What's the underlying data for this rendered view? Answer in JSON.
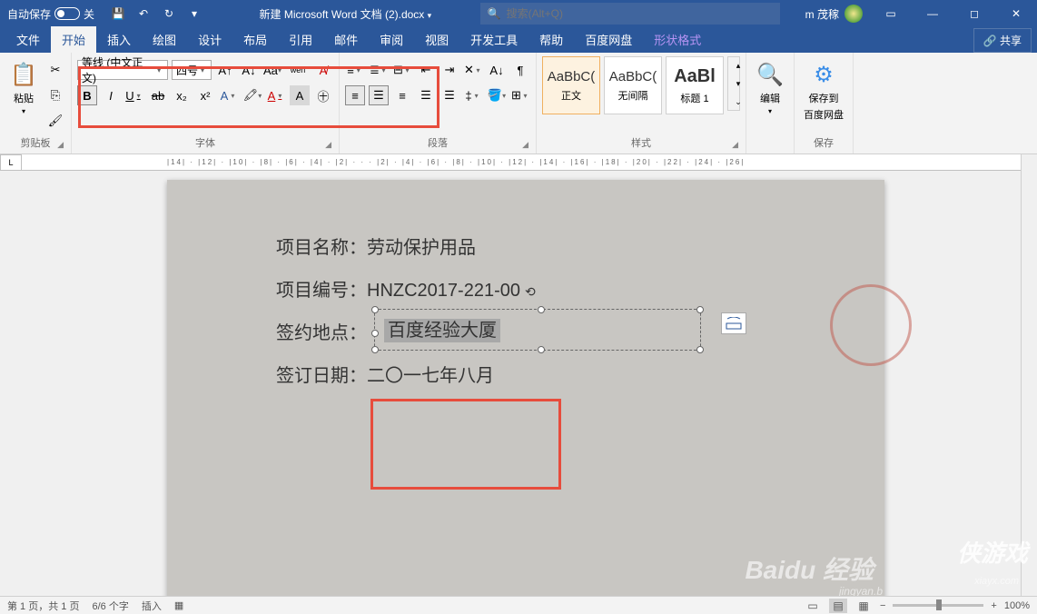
{
  "titlebar": {
    "autosave_label": "自动保存",
    "autosave_state": "关",
    "title": "新建 Microsoft Word 文档 (2).docx",
    "search_placeholder": "搜索(Alt+Q)",
    "user": "m 茂稼"
  },
  "tabs": [
    "文件",
    "开始",
    "插入",
    "绘图",
    "设计",
    "布局",
    "引用",
    "邮件",
    "审阅",
    "视图",
    "开发工具",
    "帮助",
    "百度网盘",
    "形状格式"
  ],
  "active_tab": "开始",
  "share_label": "共享",
  "ribbon": {
    "clipboard": {
      "paste": "粘贴",
      "group": "剪贴板"
    },
    "font": {
      "name": "等线 (中文正文)",
      "size": "四号",
      "group": "字体"
    },
    "paragraph": {
      "group": "段落"
    },
    "styles": {
      "group": "样式",
      "items": [
        {
          "preview": "AaBbC(",
          "name": "正文"
        },
        {
          "preview": "AaBbC(",
          "name": "无间隔"
        },
        {
          "preview": "AaBl",
          "name": "标题 1"
        }
      ]
    },
    "editing": {
      "label": "编辑"
    },
    "baidu": {
      "line1": "保存到",
      "line2": "百度网盘",
      "group": "保存"
    }
  },
  "ruler_h": "|14| · |12| · |10| · |8| · |6| · |4| · |2| · · · |2| · |4| · |6| · |8| · |10| · |12| · |14| · |16| · |18| · |20| · |22| · |24| · |26|",
  "document": {
    "line1_label": "项目名称：",
    "line1_value": "劳动保护用品",
    "line2_label": "项目编号：",
    "line2_value": "HNZC2017-221-00",
    "line3_label": "签约地点：",
    "line3_value": "百度经验大厦",
    "line4_label": "签订日期：",
    "line4_value": "二〇一七年八月"
  },
  "statusbar": {
    "page": "第 1 页，共 1 页",
    "words": "6/6 个字",
    "mode": "插入",
    "zoom": "100%"
  },
  "watermarks": {
    "baidu": "Baidu 经验",
    "jingyan": "jingyan.b",
    "xiayx": "xiayx.com",
    "game": "侠游戏"
  }
}
